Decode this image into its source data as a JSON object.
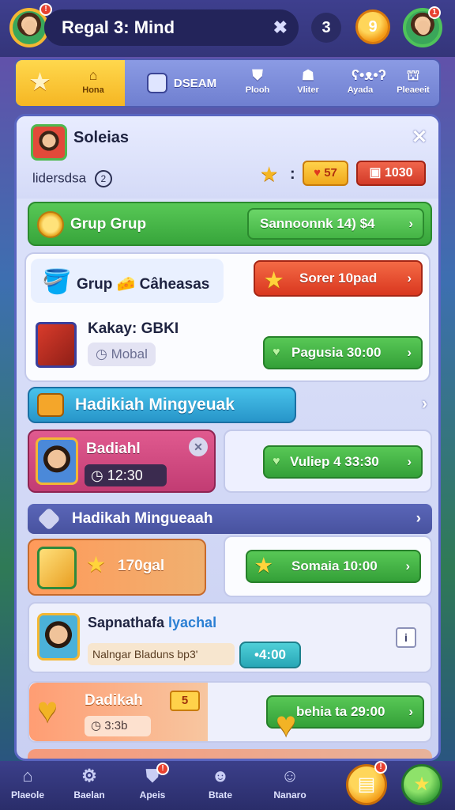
{
  "header": {
    "title": "Regal 3: Mind",
    "count": "3",
    "coin_symbol": "9",
    "left_avatar_badge": "!",
    "right_avatar_badge": "1"
  },
  "tabs": [
    {
      "label": "",
      "icon": "star-icon"
    },
    {
      "label": "Hona",
      "icon": "home-icon"
    },
    {
      "label": "DSEAM",
      "icon": "team-icon"
    },
    {
      "label": "Plooh",
      "icon": "shield-icon"
    },
    {
      "label": "Vliter",
      "icon": "helmet-icon"
    },
    {
      "label": "Ayada",
      "icon": "bear-icon"
    },
    {
      "label": "Pleaeeit",
      "icon": "house-icon"
    }
  ],
  "panel": {
    "title": "Soleias",
    "subtitle": "lidersdsa",
    "subtitle_info": "2",
    "close_label": "✕",
    "colon": ":",
    "yellow_value": "57",
    "red_value": "1030",
    "green_bar": {
      "label": "Grup Grup",
      "button": "Sannoonnk 14) $4",
      "chevron": "›"
    },
    "card_white": {
      "row1_label": "Grup 🧀 Câheasas",
      "row1_button": "Sorer 10pad",
      "row2_label": "Kakay: GBKI",
      "row2_tag": "Mobal",
      "row2_button": "Pagusia 30:00"
    },
    "section1": {
      "title": "Hadikiah Mingyeuak",
      "chevron": "›"
    },
    "pink_card": {
      "name": "Badiahl",
      "timer": "12:30",
      "close_label": "✕"
    },
    "light_card_button": "Vuliep 4 33:30",
    "section2": {
      "title": "Hadikah Mingueaah",
      "chevron": "›"
    },
    "orange_card": {
      "value": "170gal"
    },
    "orange_right_button": "Somaia 10:00",
    "list_card": {
      "name_part1": "Sapnathafa ",
      "name_part2": "lyachal",
      "sub": "Nalngar Bladuns bp3'",
      "time": "•4:00",
      "info": "i"
    },
    "bottom_card": {
      "name": "Dadikah",
      "score": "5",
      "tag": "3:3b",
      "button": "behia ta 29:00"
    }
  },
  "bottom_nav": [
    {
      "label": "Plaeole",
      "icon": "home-icon"
    },
    {
      "label": "Baelan",
      "icon": "gear-icon"
    },
    {
      "label": "Apeis",
      "icon": "shield-icon"
    },
    {
      "label": "Btate",
      "icon": "bear-icon"
    },
    {
      "label": "Nanaro",
      "icon": "person-icon"
    }
  ],
  "bottom_nav_badges": {
    "apeis": "!",
    "gold_button": "!"
  },
  "colors": {
    "accent_gold": "#f5b623",
    "green": "#44b445",
    "red": "#d9371f",
    "panel": "#dfe4fb"
  }
}
